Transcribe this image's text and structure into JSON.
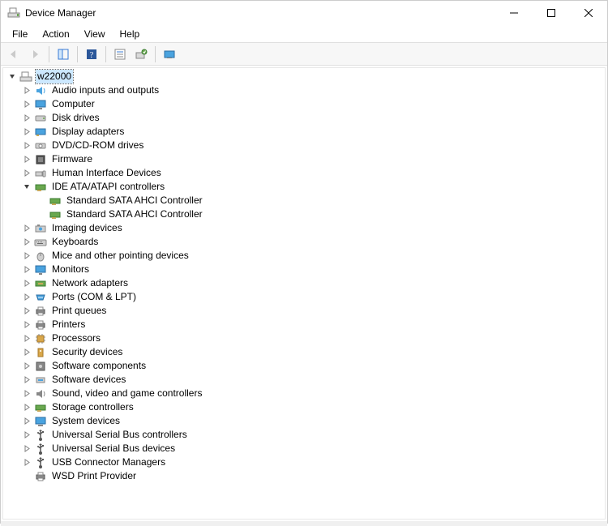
{
  "window": {
    "title": "Device Manager"
  },
  "menu": {
    "file": "File",
    "action": "Action",
    "view": "View",
    "help": "Help"
  },
  "tree": {
    "root": "w22000",
    "items": {
      "audio": "Audio inputs and outputs",
      "computer": "Computer",
      "disk": "Disk drives",
      "display": "Display adapters",
      "dvd": "DVD/CD-ROM drives",
      "firmware": "Firmware",
      "hid": "Human Interface Devices",
      "ide": "IDE ATA/ATAPI controllers",
      "ide_child1": "Standard SATA AHCI Controller",
      "ide_child2": "Standard SATA AHCI Controller",
      "imaging": "Imaging devices",
      "keyboards": "Keyboards",
      "mice": "Mice and other pointing devices",
      "monitors": "Monitors",
      "network": "Network adapters",
      "ports": "Ports (COM & LPT)",
      "printqueues": "Print queues",
      "printers": "Printers",
      "processors": "Processors",
      "security": "Security devices",
      "swcomponents": "Software components",
      "swdevices": "Software devices",
      "sound": "Sound, video and game controllers",
      "storage": "Storage controllers",
      "system": "System devices",
      "usbcontrollers": "Universal Serial Bus controllers",
      "usbdevices": "Universal Serial Bus devices",
      "usbconnector": "USB Connector Managers",
      "wsd": "WSD Print Provider"
    }
  }
}
